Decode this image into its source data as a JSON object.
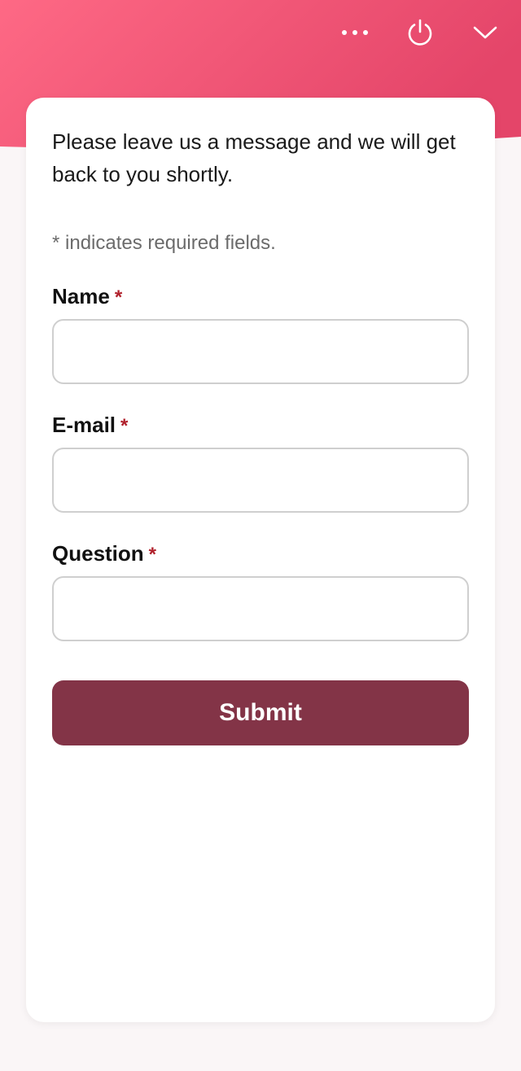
{
  "theme": {
    "header_gradient_start": "#fd6482",
    "header_gradient_end": "#e34468",
    "accent": "#833447",
    "required_color": "#b0202b"
  },
  "header": {
    "icons": [
      {
        "name": "more-options-icon"
      },
      {
        "name": "power-icon"
      },
      {
        "name": "chevron-down-icon"
      }
    ]
  },
  "form": {
    "intro": "Please leave us a message and we will get back to you shortly.",
    "required_note": "* indicates required fields.",
    "fields": [
      {
        "label": "Name",
        "required_mark": "*",
        "value": "",
        "placeholder": ""
      },
      {
        "label": "E-mail",
        "required_mark": "*",
        "value": "",
        "placeholder": ""
      },
      {
        "label": "Question",
        "required_mark": "*",
        "value": "",
        "placeholder": ""
      }
    ],
    "submit_label": "Submit"
  }
}
